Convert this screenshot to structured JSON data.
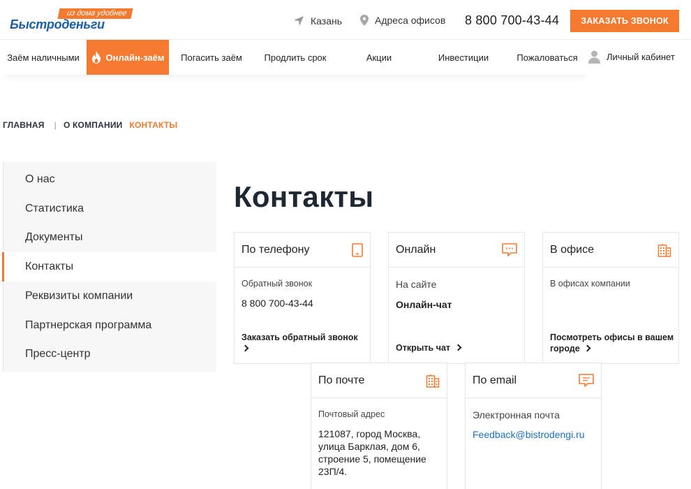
{
  "logo": {
    "tagline": "из дома удобнее",
    "brand": "Быстроденьги"
  },
  "header": {
    "city": "Казань",
    "offices": "Адреса офисов",
    "phone": "8 800 700-43-44",
    "call_button": "ЗАКАЗАТЬ ЗВОНОК"
  },
  "nav": {
    "items": [
      {
        "label": "Заём наличными"
      },
      {
        "label": "Онлайн-заём"
      },
      {
        "label": "Погасить заём"
      },
      {
        "label": "Продлить срок"
      },
      {
        "label": "Акции"
      },
      {
        "label": "Инвестиции"
      },
      {
        "label": "Пожаловаться"
      }
    ],
    "cabinet": "Личный кабинет"
  },
  "breadcrumb": {
    "home": "ГЛАВНАЯ",
    "company": "О КОМПАНИИ",
    "current": "КОНТАКТЫ"
  },
  "sidebar": {
    "items": [
      {
        "label": "О нас"
      },
      {
        "label": "Статистика"
      },
      {
        "label": "Документы"
      },
      {
        "label": "Контакты"
      },
      {
        "label": "Реквизиты компании"
      },
      {
        "label": "Партнерская программа"
      },
      {
        "label": "Пресс-центр"
      }
    ]
  },
  "page_title": "Контакты",
  "cards": {
    "phone": {
      "title": "По телефону",
      "label": "Обратный звонок",
      "value": "8 800 700-43-44",
      "link": "Заказать обратный звонок"
    },
    "online": {
      "title": "Онлайн",
      "label": "На сайте",
      "value": "Онлайн-чат",
      "link": "Открыть чат"
    },
    "office": {
      "title": "В офисе",
      "label": "В офисах компании",
      "link": "Посмотреть офисы в вашем городе"
    },
    "mail": {
      "title": "По почте",
      "label": "Почтовый адрес",
      "value": "121087, город Москва, улица Барклая, дом 6, строение 5, помещение 23П/4."
    },
    "email": {
      "title": "По email",
      "label": "Электронная почта",
      "value": "Feedback@bistrodengi.ru"
    }
  },
  "colors": {
    "accent": "#f47a30",
    "brand": "#1c5fa8",
    "link": "#1c70c0"
  }
}
